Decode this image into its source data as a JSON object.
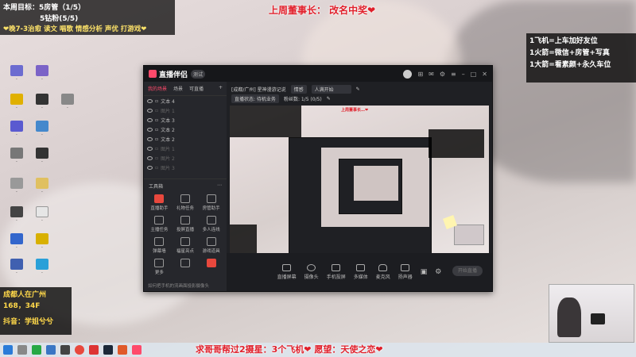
{
  "overlay": {
    "weekly_goal": "本周目标：5房管（1/5）",
    "diamond_fans": "5钻粉(5/5)",
    "schedule": "❤晚7-3治愈 读文 唱歌 情感分析 声优 打游戏❤",
    "last_week": "上周董事长：  改名中奖❤",
    "right_notes": [
      "1飞机=上车加好友位",
      "1火箭=微信+房管+写真",
      "1大箭=看素颜+永久车位"
    ],
    "location": "成都人在广州",
    "body_stats": "168，34F",
    "douyin": "抖音：学姐兮兮",
    "bottom_banner": "求哥哥帮过2摄星：3个飞机❤     愿望：天使之恋❤"
  },
  "app": {
    "title": "直播伴侣",
    "version_badge": "测试",
    "left_tabs": [
      "我的场景",
      "场景",
      "可直播"
    ],
    "sources": [
      {
        "label": "文本 4",
        "dim": false
      },
      {
        "label": "图片 1",
        "dim": true
      },
      {
        "label": "文本 3",
        "dim": false
      },
      {
        "label": "文本 2",
        "dim": false
      },
      {
        "label": "文本 2",
        "dim": false
      },
      {
        "label": "图片 1",
        "dim": true
      },
      {
        "label": "图片 2",
        "dim": true
      },
      {
        "label": "图片 3",
        "dim": true
      }
    ],
    "tools_header": "工具箱",
    "tools": [
      "直播助手",
      "礼物任务",
      "房管助手",
      "主播任务",
      "投屏直播",
      "多人连线",
      "弹幕墙",
      "福星亮点",
      "游戏道具",
      "更多",
      "",
      ""
    ],
    "bottom_tip": "如何把手机的流画面投影摄像头",
    "main_top": {
      "room_info": "[成都/广州] 星神漫游记说",
      "category": "情感",
      "input_placeholder": "人满开始",
      "status_label": "直播状态: 待机业务",
      "stats": "粉丝数: 1/5 (0/5)"
    },
    "bottom_items": [
      "直播屏幕",
      "摄像头",
      "手机投屏",
      "多媒体",
      "麦克风",
      "扬声器"
    ],
    "start_button": "开始直播"
  }
}
